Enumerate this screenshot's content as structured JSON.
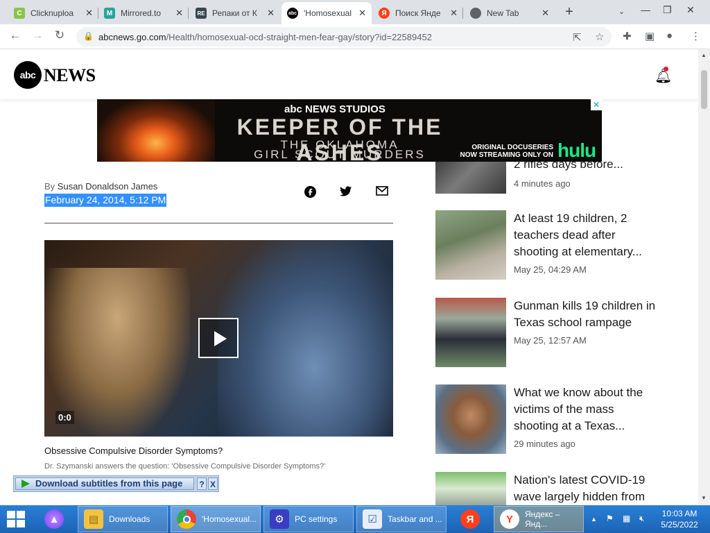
{
  "tabs": [
    {
      "title": "Clicknuploa",
      "fav": "C",
      "favcolor": "#8bc34a"
    },
    {
      "title": "Mirrored.to",
      "fav": "M",
      "favcolor": "#26a69a"
    },
    {
      "title": "Репаки от К",
      "fav": "RE",
      "favcolor": "#37474f"
    },
    {
      "title": "'Homosexual",
      "fav": "abc",
      "favcolor": "#000000"
    },
    {
      "title": "Поиск Янде",
      "fav": "Я",
      "favcolor": "#fc3f1d"
    },
    {
      "title": "New Tab",
      "fav": "",
      "favcolor": "#5f6368"
    }
  ],
  "toolbar": {
    "url_host": "abcnews.go.com",
    "url_path": "/Health/homosexual-ocd-straight-men-fear-gay/story?id=22589452"
  },
  "header": {
    "logo_mark": "abc",
    "logo_word": "NEWS"
  },
  "ad": {
    "studios": "abc NEWS STUDIOS",
    "headline": "KEEPER OF THE ASHES",
    "line2": "THE OKLAHOMA",
    "line3": "GIRL SCOUT MURDERS",
    "docu": "ORIGINAL DOCUSERIES",
    "streaming": "NOW STREAMING ONLY ON",
    "brand": "hulu"
  },
  "article": {
    "byline_prefix": "By",
    "author": "Susan Donaldson James",
    "date": "February 24, 2014, 5:12 PM",
    "video_time": "0:0",
    "video_title": "Obsessive Compulsive Disorder Symptoms?",
    "video_subtitle": "Dr. Szymanski answers the question: 'Obsessive Compulsive Disorder Symptoms?'"
  },
  "extension_bar": {
    "label": "Download subtitles from this page",
    "help": "?",
    "close": "X"
  },
  "stories": [
    {
      "title": "2 rifles days before...",
      "time": "4 minutes ago"
    },
    {
      "title": "At least 19 children, 2 teachers dead after shooting at elementary...",
      "time": "May 25, 04:29 AM"
    },
    {
      "title": "Gunman kills 19 children in Texas school rampage",
      "time": "May 25, 12:57 AM"
    },
    {
      "title": "What we know about the victims of the mass shooting at a Texas...",
      "time": "29 minutes ago"
    },
    {
      "title": "Nation's latest COVID-19 wave largely hidden from",
      "time": ""
    }
  ],
  "taskbar": {
    "items": [
      {
        "label": "Downloads"
      },
      {
        "label": "'Homosexual..."
      },
      {
        "label": "PC settings"
      },
      {
        "label": "Taskbar and ..."
      },
      {
        "label": "Яндекс – Янд..."
      }
    ],
    "time": "10:03 AM",
    "date": "5/25/2022"
  }
}
